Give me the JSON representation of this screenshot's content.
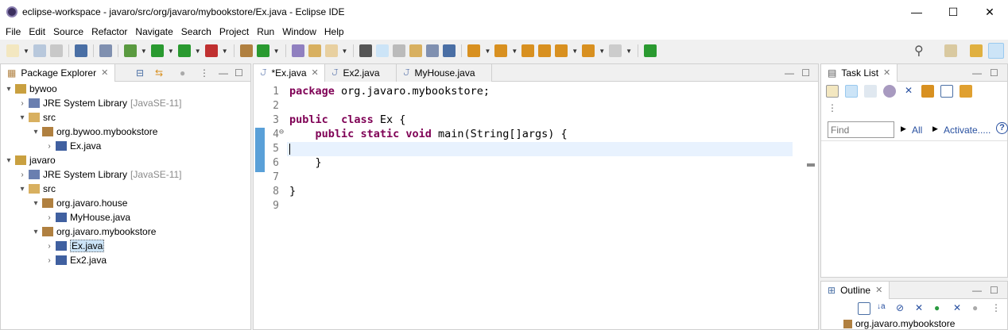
{
  "window": {
    "title": "eclipse-workspace - javaro/src/org/javaro/mybookstore/Ex.java - Eclipse IDE",
    "minimize": "—",
    "maximize": "☐",
    "close": "✕"
  },
  "menu": [
    "File",
    "Edit",
    "Source",
    "Refactor",
    "Navigate",
    "Search",
    "Project",
    "Run",
    "Window",
    "Help"
  ],
  "package_explorer": {
    "title": "Package Explorer",
    "tree": [
      {
        "label": "bywoo",
        "level": 0,
        "twisty": "▾",
        "icon": "project",
        "color": "#c9a040"
      },
      {
        "label": "JRE System Library",
        "extra": "[JavaSE-11]",
        "level": 1,
        "twisty": "›",
        "icon": "library",
        "color": "#6a7fb0"
      },
      {
        "label": "src",
        "level": 1,
        "twisty": "▾",
        "icon": "folder",
        "color": "#d8b060"
      },
      {
        "label": "org.bywoo.mybookstore",
        "level": 2,
        "twisty": "▾",
        "icon": "package",
        "color": "#b08040"
      },
      {
        "label": "Ex.java",
        "level": 3,
        "twisty": "›",
        "icon": "java-file",
        "color": "#4060a0"
      },
      {
        "label": "javaro",
        "level": 0,
        "twisty": "▾",
        "icon": "project",
        "color": "#c9a040"
      },
      {
        "label": "JRE System Library",
        "extra": "[JavaSE-11]",
        "level": 1,
        "twisty": "›",
        "icon": "library",
        "color": "#6a7fb0"
      },
      {
        "label": "src",
        "level": 1,
        "twisty": "▾",
        "icon": "folder",
        "color": "#d8b060"
      },
      {
        "label": "org.javaro.house",
        "level": 2,
        "twisty": "▾",
        "icon": "package",
        "color": "#b08040"
      },
      {
        "label": "MyHouse.java",
        "level": 3,
        "twisty": "›",
        "icon": "java-file",
        "color": "#4060a0"
      },
      {
        "label": "org.javaro.mybookstore",
        "level": 2,
        "twisty": "▾",
        "icon": "package",
        "color": "#b08040"
      },
      {
        "label": "Ex.java",
        "level": 3,
        "twisty": "›",
        "icon": "java-file",
        "color": "#4060a0",
        "selected": true
      },
      {
        "label": "Ex2.java",
        "level": 3,
        "twisty": "›",
        "icon": "java-file",
        "color": "#4060a0"
      }
    ]
  },
  "editor": {
    "tabs": [
      {
        "label": "*Ex.java",
        "active": true
      },
      {
        "label": "Ex2.java"
      },
      {
        "label": "MyHouse.java"
      }
    ],
    "lines": [
      {
        "n": "1",
        "parts": [
          [
            "kw",
            "package"
          ],
          [
            "",
            "org.javaro.mybookstore;"
          ]
        ]
      },
      {
        "n": "2",
        "parts": []
      },
      {
        "n": "3",
        "parts": [
          [
            "kw",
            "public"
          ],
          [
            "",
            ""
          ],
          [
            "kw",
            "class"
          ],
          [
            "",
            "Ex {"
          ]
        ]
      },
      {
        "n": "4",
        "fold": "⊖",
        "parts": [
          [
            "",
            "   "
          ],
          [
            "kw",
            "public"
          ],
          [
            "kw",
            "static"
          ],
          [
            "kw",
            "void"
          ],
          [
            "",
            "main(String[]args) {"
          ]
        ]
      },
      {
        "n": "5",
        "parts": [],
        "current": true
      },
      {
        "n": "6",
        "parts": [
          [
            "",
            "    }"
          ]
        ]
      },
      {
        "n": "7",
        "parts": []
      },
      {
        "n": "8",
        "parts": [
          [
            "",
            "}"
          ]
        ]
      },
      {
        "n": "9",
        "parts": []
      }
    ]
  },
  "task_list": {
    "title": "Task List",
    "find_placeholder": "Find",
    "all": "All",
    "activate": "Activate.....",
    "help": "?"
  },
  "outline": {
    "title": "Outline",
    "item": "org.javaro.mybookstore"
  }
}
